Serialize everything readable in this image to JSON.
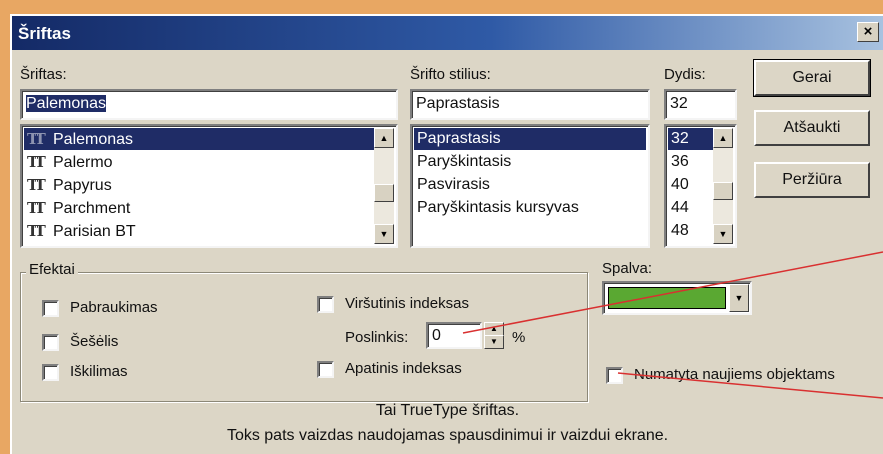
{
  "dialog": {
    "title": "Šriftas",
    "close_icon": "close-icon"
  },
  "font": {
    "label": "Šriftas:",
    "value": "Palemonas",
    "items": [
      "Palemonas",
      "Palermo",
      "Papyrus",
      "Parchment",
      "Parisian BT"
    ],
    "selected_index": 0,
    "item_icon": "truetype-icon",
    "item_icon_glyph": "TT"
  },
  "style": {
    "label": "Šrifto stilius:",
    "value": "Paprastasis",
    "items": [
      "Paprastasis",
      "Paryškintasis",
      "Pasvirasis",
      "Paryškintasis kursyvas"
    ],
    "selected_index": 0
  },
  "size": {
    "label": "Dydis:",
    "value": "32",
    "items": [
      "32",
      "36",
      "40",
      "44",
      "48"
    ],
    "selected_index": 0
  },
  "buttons": {
    "ok": "Gerai",
    "cancel": "Atšaukti",
    "preview": "Peržiūra"
  },
  "effects": {
    "title": "Efektai",
    "strikethrough": "Pabraukimas",
    "shadow": "Šešėlis",
    "emboss": "Iškilimas",
    "superscript": "Viršutinis indeksas",
    "subscript": "Apatinis indeksas",
    "offset_label": "Poslinkis:",
    "offset_value": "0",
    "offset_unit": "%"
  },
  "color": {
    "label": "Spalva:",
    "value_hex": "#5aa832"
  },
  "default_checkbox": "Numatyta naujiems objektams",
  "info": {
    "line1": "Tai TrueType šriftas.",
    "line2": "Toks pats vaizdas naudojamas spausdinimui ir vaizdui ekrane."
  },
  "colors": {
    "titlebar_start": "#142a66",
    "selection": "#1f2c66",
    "annotation_line": "#d93030"
  }
}
